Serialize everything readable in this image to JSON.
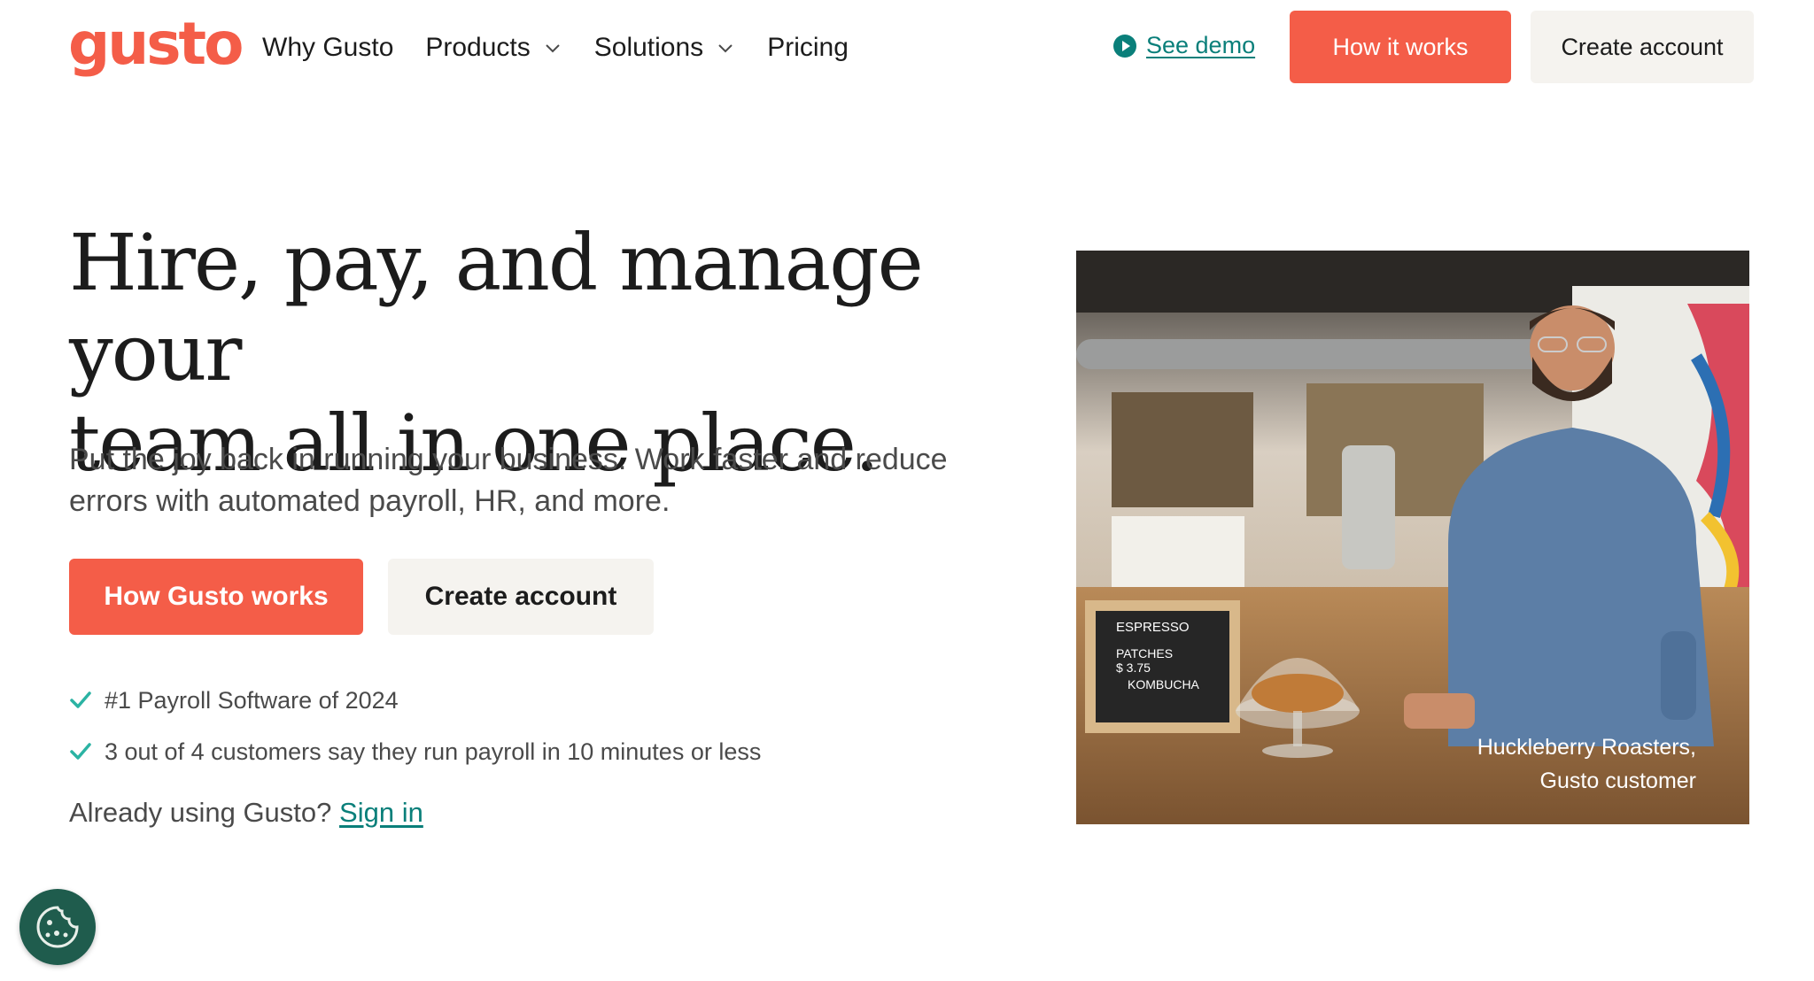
{
  "header": {
    "logo": "gusto",
    "nav": [
      {
        "label": "Why Gusto"
      },
      {
        "label": "Products"
      },
      {
        "label": "Solutions"
      },
      {
        "label": "Pricing"
      }
    ],
    "see_demo": "See demo",
    "how_it_works": "How it works",
    "create_account": "Create account"
  },
  "hero": {
    "headline_line1": "Hire, pay, and manage your",
    "headline_line2": "team all in one place.",
    "subtext": "Put the joy back in running your business. Work faster and reduce errors with automated payroll, HR, and more.",
    "primary_cta": "How Gusto works",
    "secondary_cta": "Create account",
    "checks": [
      "#1 Payroll Software of 2024",
      "3 out of 4 customers say they run payroll in 10 minutes or less"
    ],
    "already_text": "Already using Gusto?",
    "sign_in": "Sign in"
  },
  "photo": {
    "caption_line1": "Huckleberry Roasters,",
    "caption_line2": "Gusto customer",
    "sign_lines": [
      "ESPRESSO",
      "PATCHES",
      "$ 3.75",
      "KOMBUCHA"
    ]
  },
  "colors": {
    "brand": "#f45d48",
    "link": "#0a7f7a",
    "secondary_bg": "#f5f3ef",
    "cookie_bg": "#1f5c4d"
  },
  "icons": {
    "play": "play-circle-icon",
    "chevron": "chevron-down-icon",
    "check": "check-icon",
    "cookie": "cookie-icon"
  }
}
